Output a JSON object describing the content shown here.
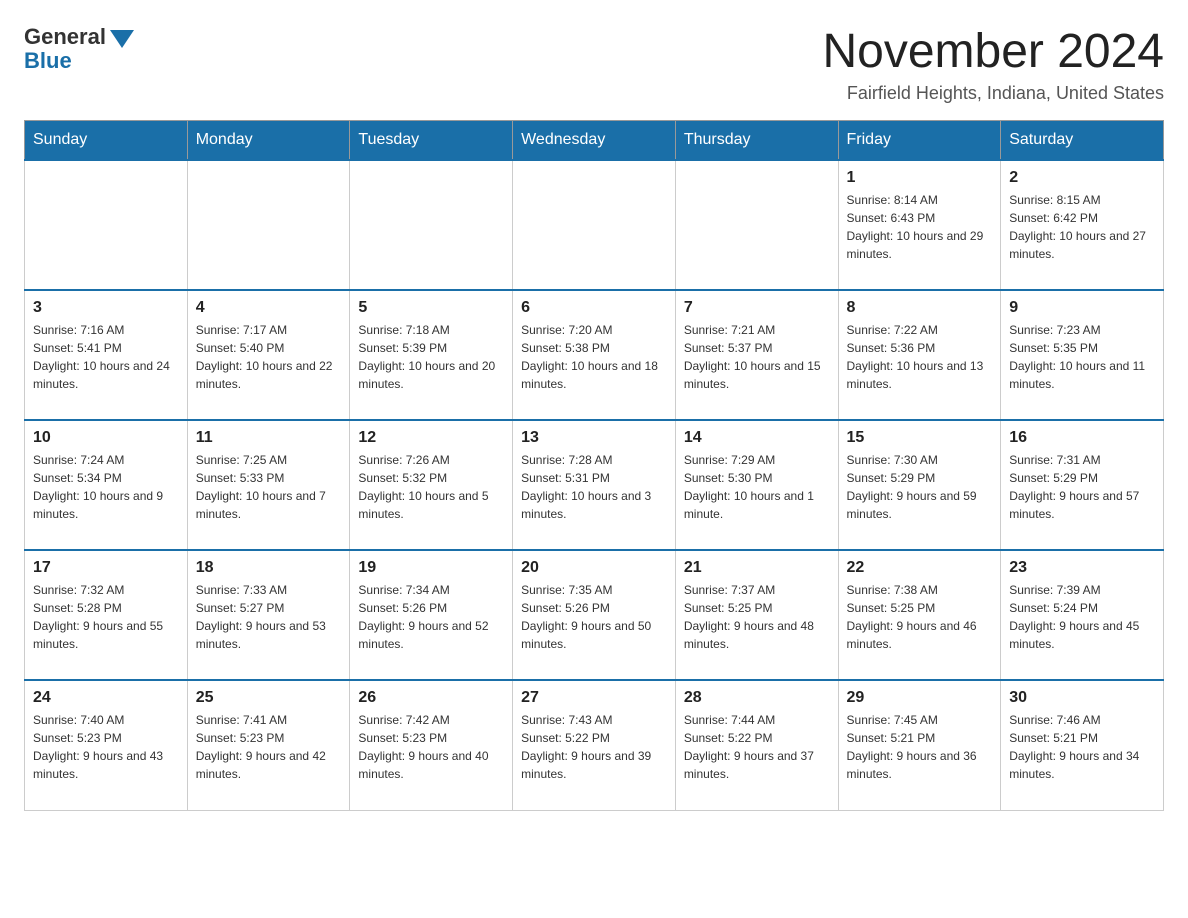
{
  "header": {
    "logo_general": "General",
    "logo_blue": "Blue",
    "month_title": "November 2024",
    "location": "Fairfield Heights, Indiana, United States"
  },
  "weekdays": [
    "Sunday",
    "Monday",
    "Tuesday",
    "Wednesday",
    "Thursday",
    "Friday",
    "Saturday"
  ],
  "weeks": [
    [
      {
        "day": "",
        "sunrise": "",
        "sunset": "",
        "daylight": ""
      },
      {
        "day": "",
        "sunrise": "",
        "sunset": "",
        "daylight": ""
      },
      {
        "day": "",
        "sunrise": "",
        "sunset": "",
        "daylight": ""
      },
      {
        "day": "",
        "sunrise": "",
        "sunset": "",
        "daylight": ""
      },
      {
        "day": "",
        "sunrise": "",
        "sunset": "",
        "daylight": ""
      },
      {
        "day": "1",
        "sunrise": "Sunrise: 8:14 AM",
        "sunset": "Sunset: 6:43 PM",
        "daylight": "Daylight: 10 hours and 29 minutes."
      },
      {
        "day": "2",
        "sunrise": "Sunrise: 8:15 AM",
        "sunset": "Sunset: 6:42 PM",
        "daylight": "Daylight: 10 hours and 27 minutes."
      }
    ],
    [
      {
        "day": "3",
        "sunrise": "Sunrise: 7:16 AM",
        "sunset": "Sunset: 5:41 PM",
        "daylight": "Daylight: 10 hours and 24 minutes."
      },
      {
        "day": "4",
        "sunrise": "Sunrise: 7:17 AM",
        "sunset": "Sunset: 5:40 PM",
        "daylight": "Daylight: 10 hours and 22 minutes."
      },
      {
        "day": "5",
        "sunrise": "Sunrise: 7:18 AM",
        "sunset": "Sunset: 5:39 PM",
        "daylight": "Daylight: 10 hours and 20 minutes."
      },
      {
        "day": "6",
        "sunrise": "Sunrise: 7:20 AM",
        "sunset": "Sunset: 5:38 PM",
        "daylight": "Daylight: 10 hours and 18 minutes."
      },
      {
        "day": "7",
        "sunrise": "Sunrise: 7:21 AM",
        "sunset": "Sunset: 5:37 PM",
        "daylight": "Daylight: 10 hours and 15 minutes."
      },
      {
        "day": "8",
        "sunrise": "Sunrise: 7:22 AM",
        "sunset": "Sunset: 5:36 PM",
        "daylight": "Daylight: 10 hours and 13 minutes."
      },
      {
        "day": "9",
        "sunrise": "Sunrise: 7:23 AM",
        "sunset": "Sunset: 5:35 PM",
        "daylight": "Daylight: 10 hours and 11 minutes."
      }
    ],
    [
      {
        "day": "10",
        "sunrise": "Sunrise: 7:24 AM",
        "sunset": "Sunset: 5:34 PM",
        "daylight": "Daylight: 10 hours and 9 minutes."
      },
      {
        "day": "11",
        "sunrise": "Sunrise: 7:25 AM",
        "sunset": "Sunset: 5:33 PM",
        "daylight": "Daylight: 10 hours and 7 minutes."
      },
      {
        "day": "12",
        "sunrise": "Sunrise: 7:26 AM",
        "sunset": "Sunset: 5:32 PM",
        "daylight": "Daylight: 10 hours and 5 minutes."
      },
      {
        "day": "13",
        "sunrise": "Sunrise: 7:28 AM",
        "sunset": "Sunset: 5:31 PM",
        "daylight": "Daylight: 10 hours and 3 minutes."
      },
      {
        "day": "14",
        "sunrise": "Sunrise: 7:29 AM",
        "sunset": "Sunset: 5:30 PM",
        "daylight": "Daylight: 10 hours and 1 minute."
      },
      {
        "day": "15",
        "sunrise": "Sunrise: 7:30 AM",
        "sunset": "Sunset: 5:29 PM",
        "daylight": "Daylight: 9 hours and 59 minutes."
      },
      {
        "day": "16",
        "sunrise": "Sunrise: 7:31 AM",
        "sunset": "Sunset: 5:29 PM",
        "daylight": "Daylight: 9 hours and 57 minutes."
      }
    ],
    [
      {
        "day": "17",
        "sunrise": "Sunrise: 7:32 AM",
        "sunset": "Sunset: 5:28 PM",
        "daylight": "Daylight: 9 hours and 55 minutes."
      },
      {
        "day": "18",
        "sunrise": "Sunrise: 7:33 AM",
        "sunset": "Sunset: 5:27 PM",
        "daylight": "Daylight: 9 hours and 53 minutes."
      },
      {
        "day": "19",
        "sunrise": "Sunrise: 7:34 AM",
        "sunset": "Sunset: 5:26 PM",
        "daylight": "Daylight: 9 hours and 52 minutes."
      },
      {
        "day": "20",
        "sunrise": "Sunrise: 7:35 AM",
        "sunset": "Sunset: 5:26 PM",
        "daylight": "Daylight: 9 hours and 50 minutes."
      },
      {
        "day": "21",
        "sunrise": "Sunrise: 7:37 AM",
        "sunset": "Sunset: 5:25 PM",
        "daylight": "Daylight: 9 hours and 48 minutes."
      },
      {
        "day": "22",
        "sunrise": "Sunrise: 7:38 AM",
        "sunset": "Sunset: 5:25 PM",
        "daylight": "Daylight: 9 hours and 46 minutes."
      },
      {
        "day": "23",
        "sunrise": "Sunrise: 7:39 AM",
        "sunset": "Sunset: 5:24 PM",
        "daylight": "Daylight: 9 hours and 45 minutes."
      }
    ],
    [
      {
        "day": "24",
        "sunrise": "Sunrise: 7:40 AM",
        "sunset": "Sunset: 5:23 PM",
        "daylight": "Daylight: 9 hours and 43 minutes."
      },
      {
        "day": "25",
        "sunrise": "Sunrise: 7:41 AM",
        "sunset": "Sunset: 5:23 PM",
        "daylight": "Daylight: 9 hours and 42 minutes."
      },
      {
        "day": "26",
        "sunrise": "Sunrise: 7:42 AM",
        "sunset": "Sunset: 5:23 PM",
        "daylight": "Daylight: 9 hours and 40 minutes."
      },
      {
        "day": "27",
        "sunrise": "Sunrise: 7:43 AM",
        "sunset": "Sunset: 5:22 PM",
        "daylight": "Daylight: 9 hours and 39 minutes."
      },
      {
        "day": "28",
        "sunrise": "Sunrise: 7:44 AM",
        "sunset": "Sunset: 5:22 PM",
        "daylight": "Daylight: 9 hours and 37 minutes."
      },
      {
        "day": "29",
        "sunrise": "Sunrise: 7:45 AM",
        "sunset": "Sunset: 5:21 PM",
        "daylight": "Daylight: 9 hours and 36 minutes."
      },
      {
        "day": "30",
        "sunrise": "Sunrise: 7:46 AM",
        "sunset": "Sunset: 5:21 PM",
        "daylight": "Daylight: 9 hours and 34 minutes."
      }
    ]
  ]
}
